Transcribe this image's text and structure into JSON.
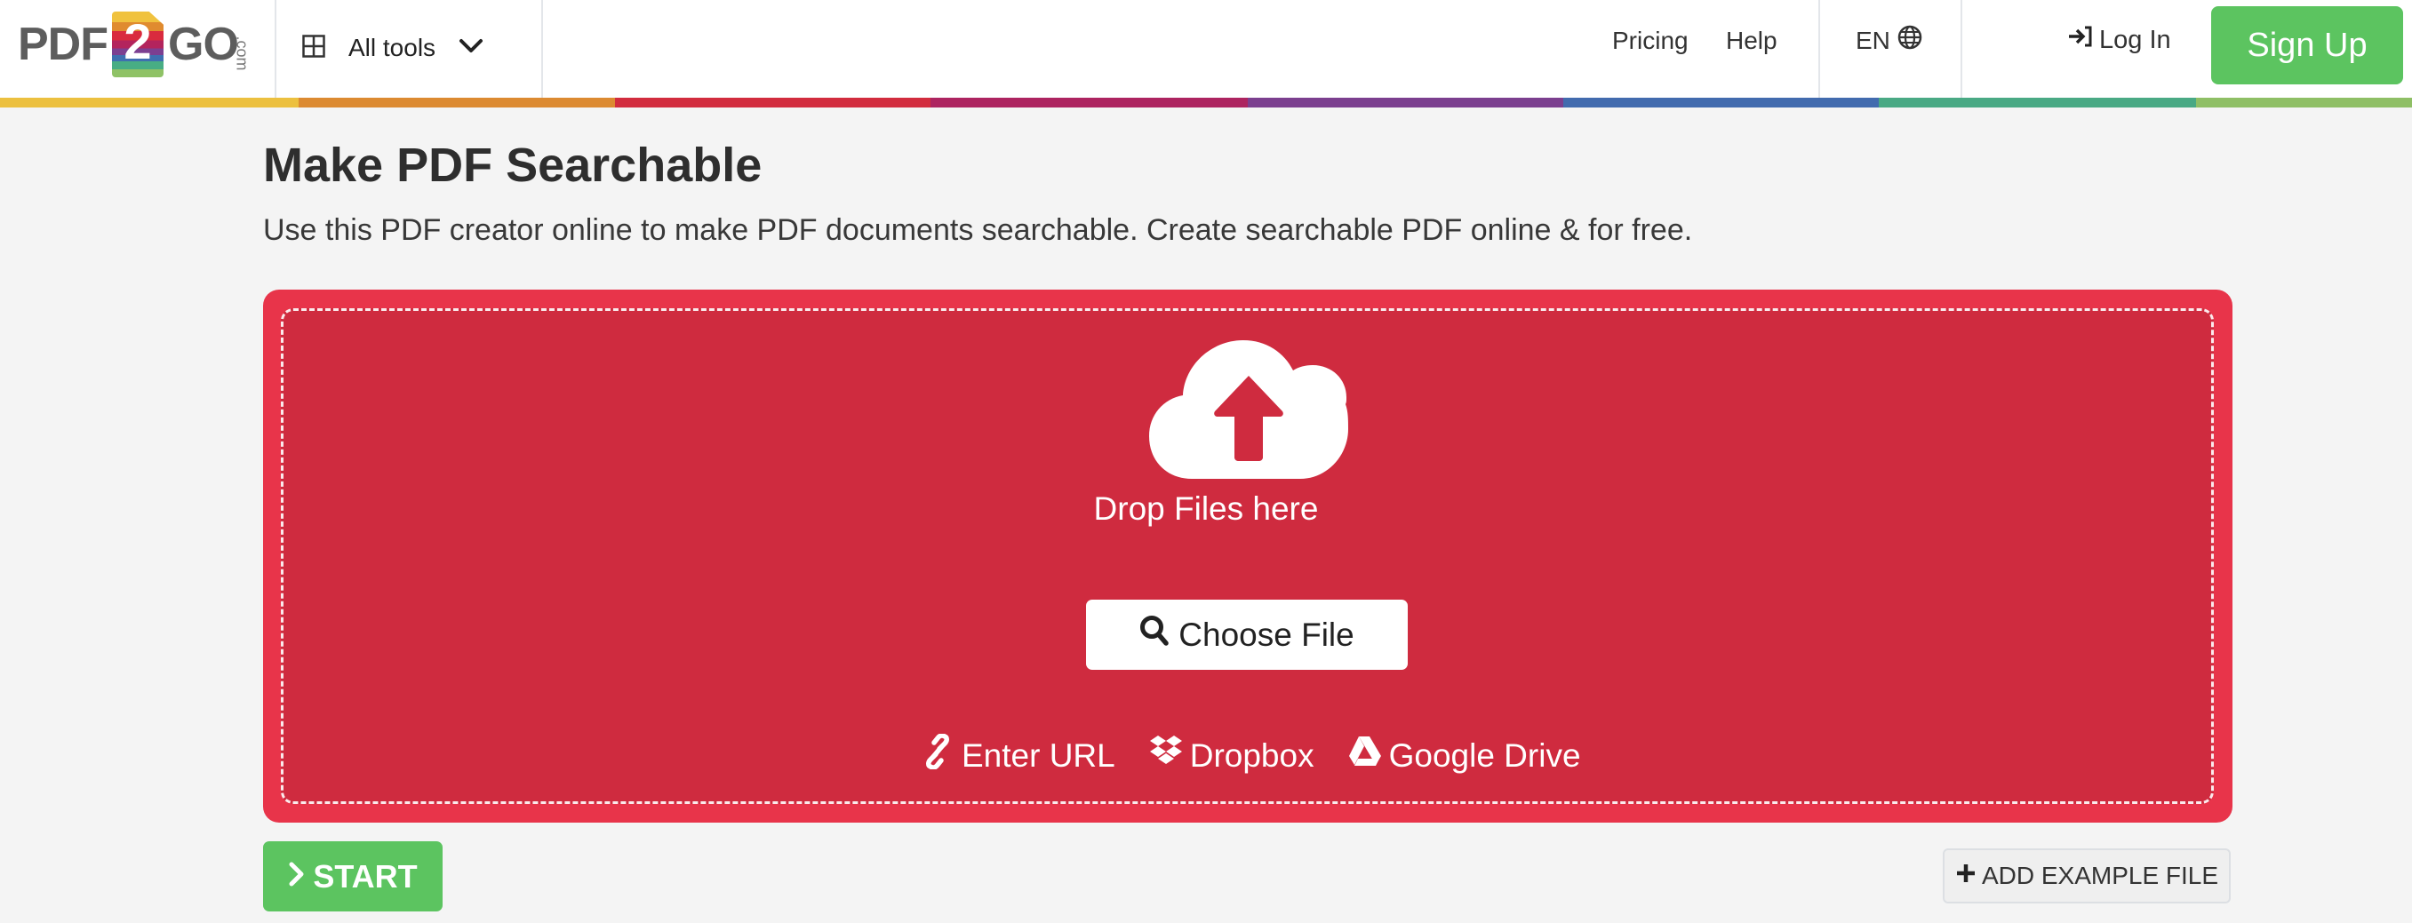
{
  "header": {
    "logo": {
      "left": "PDF",
      "badge": "2",
      "right": "GO",
      "suffix": ".com"
    },
    "all_tools_label": "All tools",
    "nav": [
      {
        "label": "Pricing"
      },
      {
        "label": "Help"
      }
    ],
    "language": "EN",
    "login_label": "Log In",
    "signup_label": "Sign Up",
    "stripe_colors": [
      "#ecc03f",
      "#dc8a31",
      "#d22c3e",
      "#ad2460",
      "#7b3f8f",
      "#426bae",
      "#49a984",
      "#8fbf65"
    ]
  },
  "page": {
    "title": "Make PDF Searchable",
    "subtitle": "Use this PDF creator online to make PDF documents searchable. Create searchable PDF online & for free."
  },
  "upload": {
    "drop_text": "Drop Files here",
    "choose_label": "Choose File",
    "sources": [
      {
        "icon": "link-icon",
        "label": "Enter URL"
      },
      {
        "icon": "dropbox-icon",
        "label": "Dropbox"
      },
      {
        "icon": "google-drive-icon",
        "label": "Google Drive"
      }
    ]
  },
  "actions": {
    "start_label": "START",
    "example_label": "ADD EXAMPLE FILE"
  },
  "colors": {
    "accent_red": "#e8344a",
    "accent_green": "#5cc460"
  }
}
